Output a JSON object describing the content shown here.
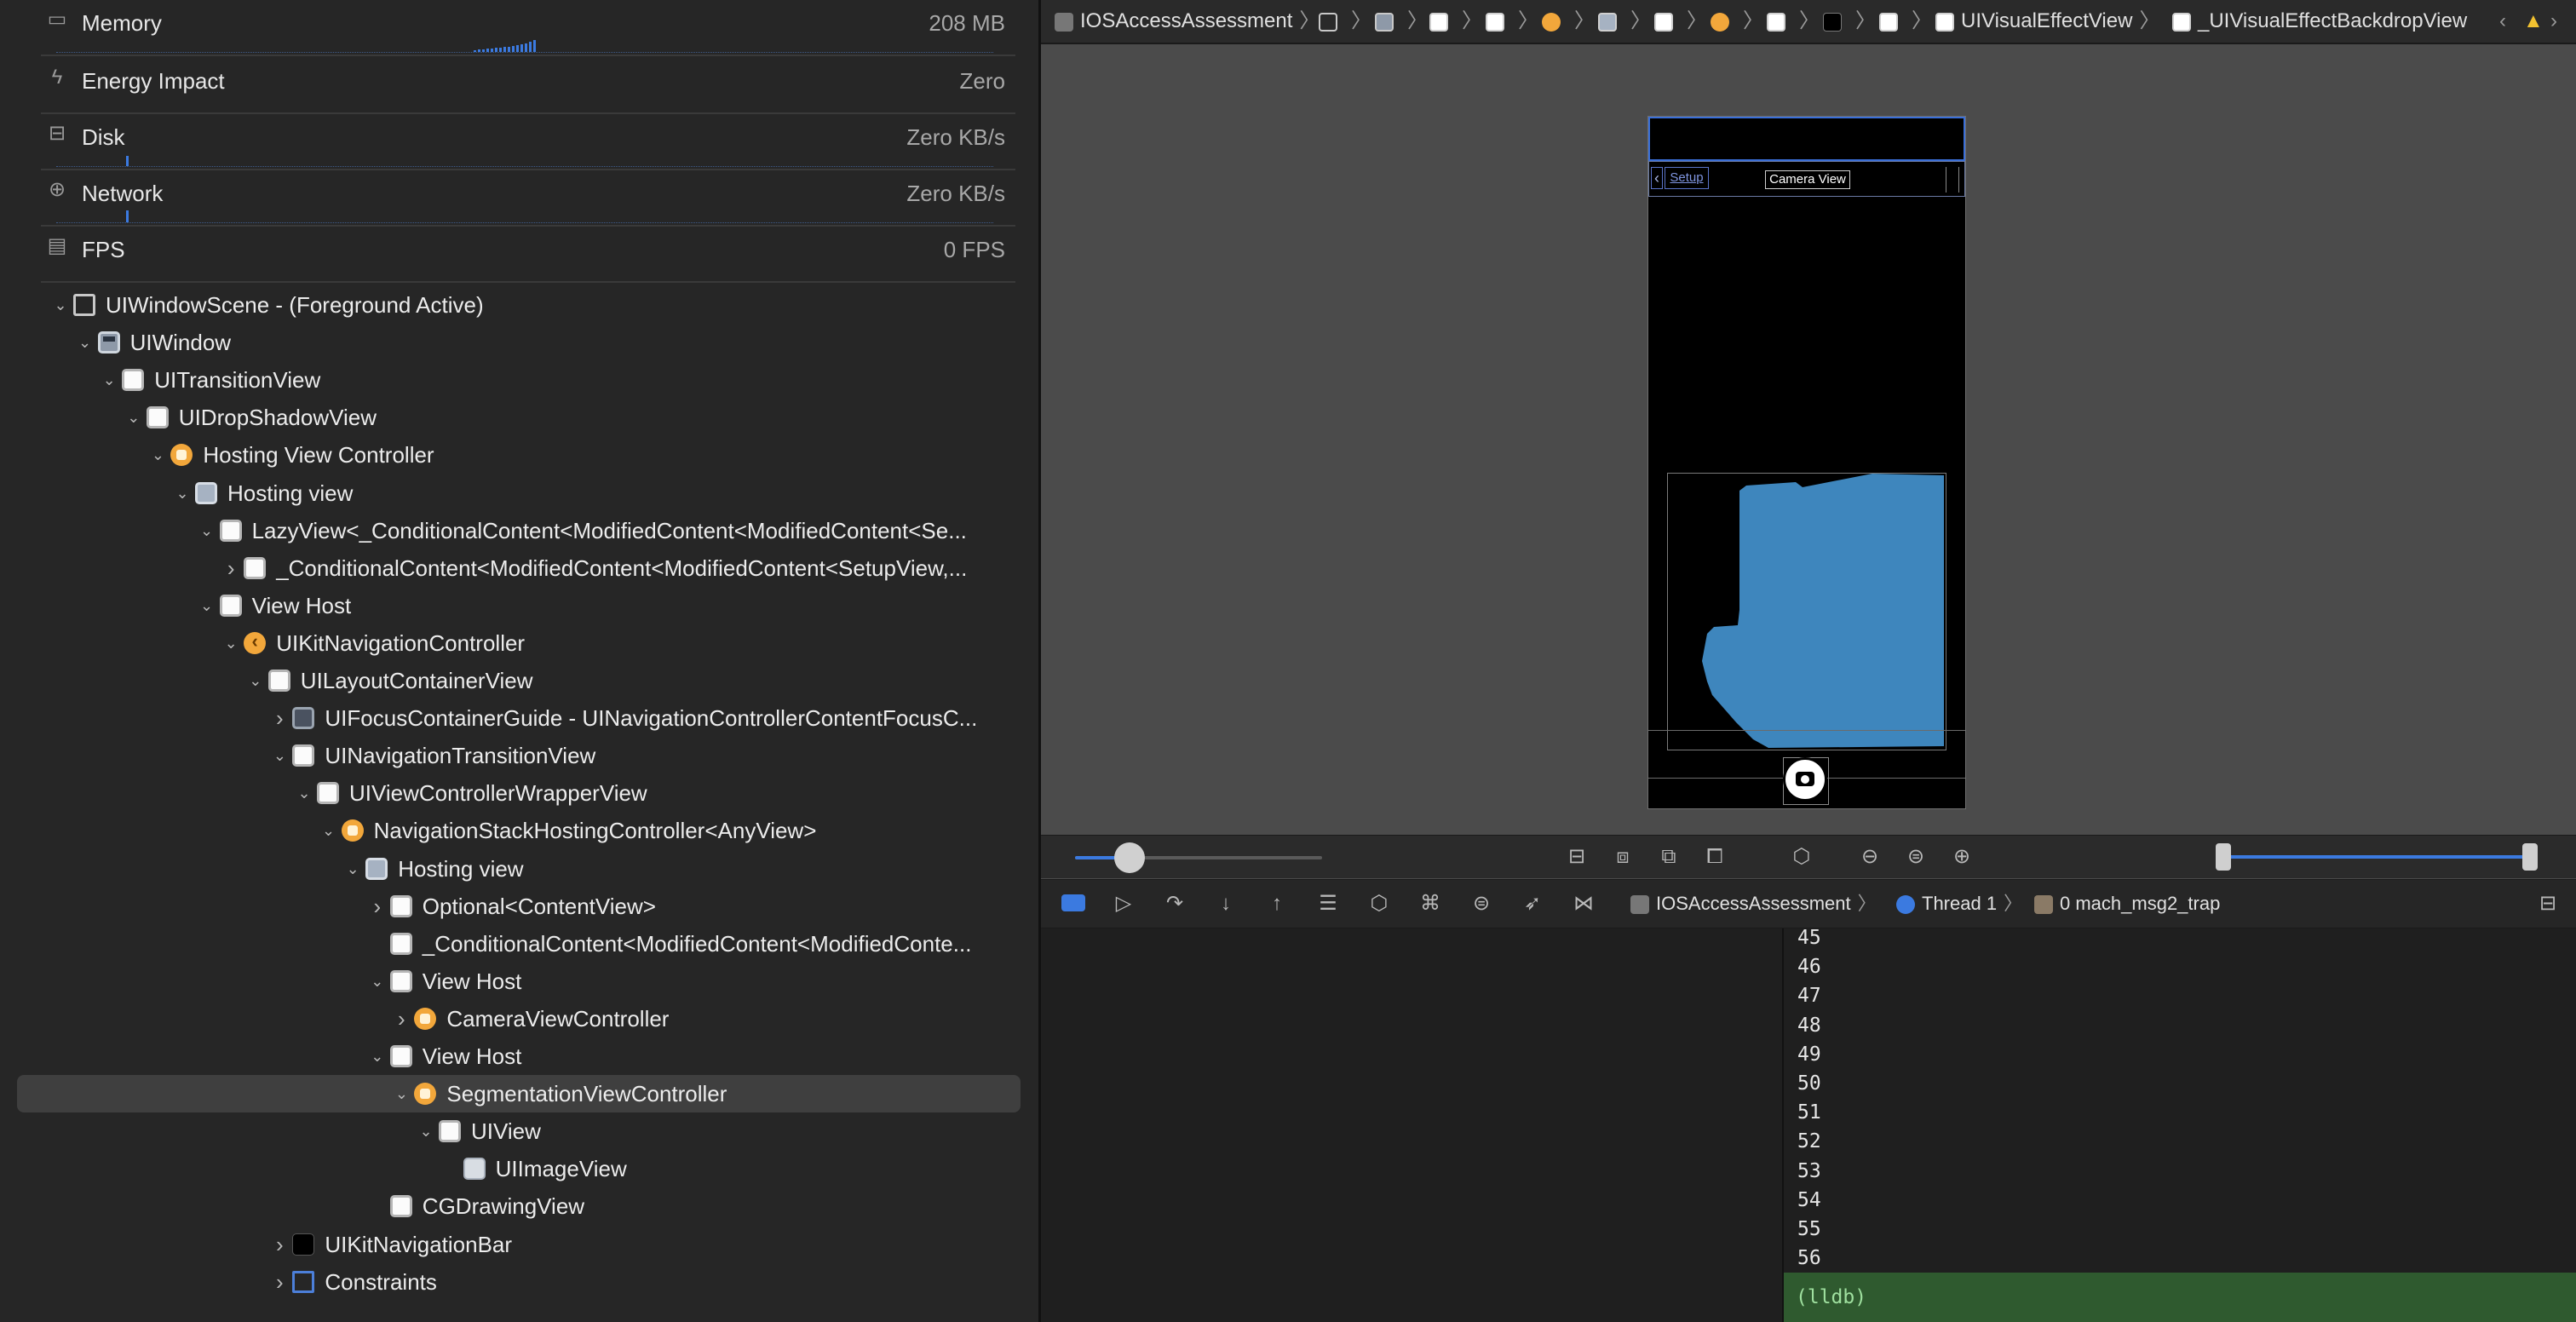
{
  "gauges": [
    {
      "label": "Memory",
      "value": "208 MB",
      "icon": "memory-icon"
    },
    {
      "label": "Energy Impact",
      "value": "Zero",
      "icon": "bolt-icon"
    },
    {
      "label": "Disk",
      "value": "Zero KB/s",
      "icon": "disk-icon"
    },
    {
      "label": "Network",
      "value": "Zero KB/s",
      "icon": "globe-icon"
    },
    {
      "label": "FPS",
      "value": "0 FPS",
      "icon": "film-icon"
    }
  ],
  "tree": [
    {
      "label": "UIWindowScene - (Foreground Active)",
      "icon": "scene",
      "depth": 0,
      "exp": "down"
    },
    {
      "label": "UIWindow",
      "icon": "window",
      "depth": 1,
      "exp": "down"
    },
    {
      "label": "UITransitionView",
      "icon": "view",
      "depth": 2,
      "exp": "down"
    },
    {
      "label": "UIDropShadowView",
      "icon": "view",
      "depth": 3,
      "exp": "down"
    },
    {
      "label": "Hosting View Controller",
      "icon": "vc",
      "depth": 4,
      "exp": "down"
    },
    {
      "label": "Hosting view",
      "icon": "hosting",
      "depth": 5,
      "exp": "down"
    },
    {
      "label": "LazyView<_ConditionalContent<ModifiedContent<ModifiedContent<Se...",
      "icon": "view",
      "depth": 6,
      "exp": "down"
    },
    {
      "label": "_ConditionalContent<ModifiedContent<ModifiedContent<SetupView,...",
      "icon": "view",
      "depth": 7,
      "exp": "right"
    },
    {
      "label": "View Host",
      "icon": "view",
      "depth": 6,
      "exp": "down"
    },
    {
      "label": "UIKitNavigationController",
      "icon": "navvc",
      "depth": 7,
      "exp": "down"
    },
    {
      "label": "UILayoutContainerView",
      "icon": "view",
      "depth": 8,
      "exp": "down"
    },
    {
      "label": "UIFocusContainerGuide - UINavigationControllerContentFocusC...",
      "icon": "guide",
      "depth": 9,
      "exp": "right"
    },
    {
      "label": "UINavigationTransitionView",
      "icon": "view",
      "depth": 9,
      "exp": "down"
    },
    {
      "label": "UIViewControllerWrapperView",
      "icon": "view",
      "depth": 10,
      "exp": "down"
    },
    {
      "label": "NavigationStackHostingController<AnyView>",
      "icon": "vc",
      "depth": 11,
      "exp": "down"
    },
    {
      "label": "Hosting view",
      "icon": "hosting",
      "depth": 12,
      "exp": "down"
    },
    {
      "label": "Optional<ContentView>",
      "icon": "view",
      "depth": 13,
      "exp": "right"
    },
    {
      "label": "_ConditionalContent<ModifiedContent<ModifiedConte...",
      "icon": "view",
      "depth": 13,
      "exp": "none"
    },
    {
      "label": "View Host",
      "icon": "view",
      "depth": 13,
      "exp": "down"
    },
    {
      "label": "CameraViewController",
      "icon": "vc",
      "depth": 14,
      "exp": "right"
    },
    {
      "label": "View Host",
      "icon": "view",
      "depth": 13,
      "exp": "down"
    },
    {
      "label": "SegmentationViewController",
      "icon": "vc",
      "depth": 14,
      "exp": "down",
      "selected": true
    },
    {
      "label": "UIView",
      "icon": "view",
      "depth": 15,
      "exp": "down"
    },
    {
      "label": "UIImageView",
      "icon": "image",
      "depth": 16,
      "exp": "none"
    },
    {
      "label": "CGDrawingView",
      "icon": "view",
      "depth": 13,
      "exp": "none"
    },
    {
      "label": "UIKitNavigationBar",
      "icon": "navbar",
      "depth": 9,
      "exp": "right"
    },
    {
      "label": "Constraints",
      "icon": "constraint",
      "depth": 9,
      "exp": "right"
    }
  ],
  "jump_bar": {
    "app": "IOSAccessAssessment",
    "visual_effect_view": "UIVisualEffectView",
    "backdrop_view": "_UIVisualEffectBackdropView"
  },
  "device": {
    "back_label": "Setup",
    "title": "Camera View",
    "back_glyph": "‹"
  },
  "debug_bar": {
    "app": "IOSAccessAssessment",
    "thread": "Thread 1",
    "frame": "0 mach_msg2_trap"
  },
  "console": {
    "line_numbers": [
      "45",
      "46",
      "47",
      "48",
      "49",
      "50",
      "51",
      "52",
      "53",
      "54",
      "55",
      "56"
    ],
    "prompt": "(lldb)"
  },
  "zoom_slider_value": 0.22,
  "colors": {
    "accent": "#3b7ae0",
    "segmentation_mask": "#3e86bd",
    "warning": "#f2c230",
    "vc_orange": "#f2a73b"
  }
}
